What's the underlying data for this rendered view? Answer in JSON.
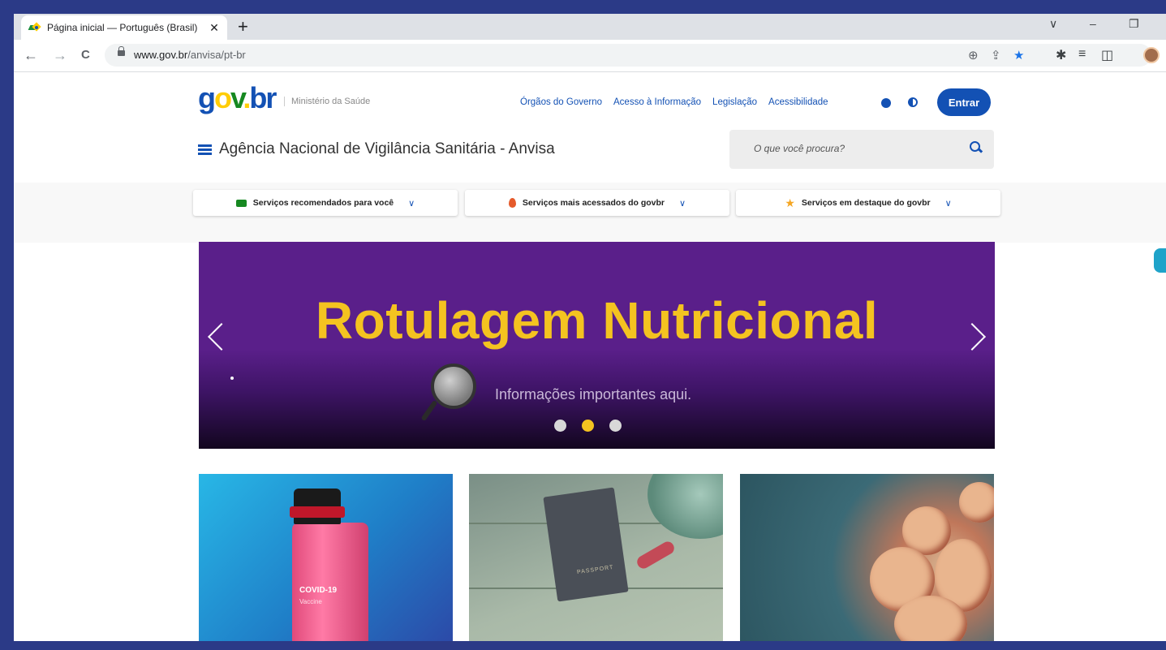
{
  "browser": {
    "tab": {
      "title": "Página inicial — Português (Brasil)",
      "close_glyph": "✕"
    },
    "new_tab_glyph": "+",
    "window_controls": {
      "tab_search": "∨",
      "minimize": "–",
      "restore": "❐"
    },
    "nav": {
      "back": "←",
      "forward": "→",
      "reload": "C"
    },
    "address": {
      "domain": "www.gov.br",
      "path": "/anvisa/pt-br"
    },
    "omnibox_icons": {
      "zoom": "⊕",
      "share": "⇪",
      "bookmark": "★"
    },
    "toolbar_icons": {
      "extensions": "✱",
      "reading_list": "≡",
      "side_panel": "◫"
    }
  },
  "header": {
    "logo": {
      "g": "g",
      "o": "o",
      "v": "v",
      "dot": ".",
      "br": "br"
    },
    "ministry": "Ministério da Saúde",
    "links": [
      "Órgãos do Governo",
      "Acesso à Informação",
      "Legislação",
      "Acessibilidade"
    ],
    "login_label": "Entrar",
    "site_title": "Agência Nacional de Vigilância Sanitária - Anvisa",
    "search_placeholder": "O que você procura?"
  },
  "services": [
    {
      "label": "Serviços recomendados para você",
      "icon": "thumbs-up-icon"
    },
    {
      "label": "Serviços mais acessados do govbr",
      "icon": "flame-icon"
    },
    {
      "label": "Serviços em destaque do govbr",
      "icon": "star-icon"
    }
  ],
  "hero": {
    "title": "Rotulagem Nutricional",
    "subtitle": "Informações importantes aqui.",
    "active_slide": 2,
    "slide_count": 3
  },
  "cards": [
    {
      "image": "covid-vaccine-vial",
      "vial_text": "COVID-19",
      "vial_subtext": "Vaccine"
    },
    {
      "image": "passport-on-table",
      "passport_text": "PASSPORT"
    },
    {
      "image": "virus-particle"
    }
  ],
  "colors": {
    "brand_blue": "#1351b4",
    "hero_purple": "#5a1f8a",
    "hero_yellow": "#f4c320",
    "govbr_green": "#168821",
    "govbr_yellow": "#ffcd07"
  }
}
